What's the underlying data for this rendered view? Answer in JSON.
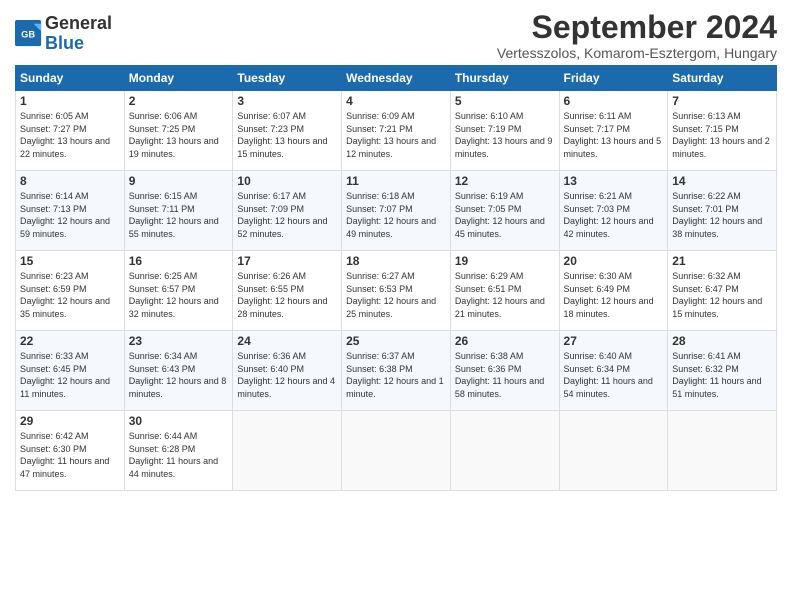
{
  "header": {
    "logo_general": "General",
    "logo_blue": "Blue",
    "month_title": "September 2024",
    "subtitle": "Vertesszolos, Komarom-Esztergom, Hungary"
  },
  "weekdays": [
    "Sunday",
    "Monday",
    "Tuesday",
    "Wednesday",
    "Thursday",
    "Friday",
    "Saturday"
  ],
  "weeks": [
    [
      {
        "day": "1",
        "sunrise": "6:05 AM",
        "sunset": "7:27 PM",
        "daylight": "13 hours and 22 minutes."
      },
      {
        "day": "2",
        "sunrise": "6:06 AM",
        "sunset": "7:25 PM",
        "daylight": "13 hours and 19 minutes."
      },
      {
        "day": "3",
        "sunrise": "6:07 AM",
        "sunset": "7:23 PM",
        "daylight": "13 hours and 15 minutes."
      },
      {
        "day": "4",
        "sunrise": "6:09 AM",
        "sunset": "7:21 PM",
        "daylight": "13 hours and 12 minutes."
      },
      {
        "day": "5",
        "sunrise": "6:10 AM",
        "sunset": "7:19 PM",
        "daylight": "13 hours and 9 minutes."
      },
      {
        "day": "6",
        "sunrise": "6:11 AM",
        "sunset": "7:17 PM",
        "daylight": "13 hours and 5 minutes."
      },
      {
        "day": "7",
        "sunrise": "6:13 AM",
        "sunset": "7:15 PM",
        "daylight": "13 hours and 2 minutes."
      }
    ],
    [
      {
        "day": "8",
        "sunrise": "6:14 AM",
        "sunset": "7:13 PM",
        "daylight": "12 hours and 59 minutes."
      },
      {
        "day": "9",
        "sunrise": "6:15 AM",
        "sunset": "7:11 PM",
        "daylight": "12 hours and 55 minutes."
      },
      {
        "day": "10",
        "sunrise": "6:17 AM",
        "sunset": "7:09 PM",
        "daylight": "12 hours and 52 minutes."
      },
      {
        "day": "11",
        "sunrise": "6:18 AM",
        "sunset": "7:07 PM",
        "daylight": "12 hours and 49 minutes."
      },
      {
        "day": "12",
        "sunrise": "6:19 AM",
        "sunset": "7:05 PM",
        "daylight": "12 hours and 45 minutes."
      },
      {
        "day": "13",
        "sunrise": "6:21 AM",
        "sunset": "7:03 PM",
        "daylight": "12 hours and 42 minutes."
      },
      {
        "day": "14",
        "sunrise": "6:22 AM",
        "sunset": "7:01 PM",
        "daylight": "12 hours and 38 minutes."
      }
    ],
    [
      {
        "day": "15",
        "sunrise": "6:23 AM",
        "sunset": "6:59 PM",
        "daylight": "12 hours and 35 minutes."
      },
      {
        "day": "16",
        "sunrise": "6:25 AM",
        "sunset": "6:57 PM",
        "daylight": "12 hours and 32 minutes."
      },
      {
        "day": "17",
        "sunrise": "6:26 AM",
        "sunset": "6:55 PM",
        "daylight": "12 hours and 28 minutes."
      },
      {
        "day": "18",
        "sunrise": "6:27 AM",
        "sunset": "6:53 PM",
        "daylight": "12 hours and 25 minutes."
      },
      {
        "day": "19",
        "sunrise": "6:29 AM",
        "sunset": "6:51 PM",
        "daylight": "12 hours and 21 minutes."
      },
      {
        "day": "20",
        "sunrise": "6:30 AM",
        "sunset": "6:49 PM",
        "daylight": "12 hours and 18 minutes."
      },
      {
        "day": "21",
        "sunrise": "6:32 AM",
        "sunset": "6:47 PM",
        "daylight": "12 hours and 15 minutes."
      }
    ],
    [
      {
        "day": "22",
        "sunrise": "6:33 AM",
        "sunset": "6:45 PM",
        "daylight": "12 hours and 11 minutes."
      },
      {
        "day": "23",
        "sunrise": "6:34 AM",
        "sunset": "6:43 PM",
        "daylight": "12 hours and 8 minutes."
      },
      {
        "day": "24",
        "sunrise": "6:36 AM",
        "sunset": "6:40 PM",
        "daylight": "12 hours and 4 minutes."
      },
      {
        "day": "25",
        "sunrise": "6:37 AM",
        "sunset": "6:38 PM",
        "daylight": "12 hours and 1 minute."
      },
      {
        "day": "26",
        "sunrise": "6:38 AM",
        "sunset": "6:36 PM",
        "daylight": "11 hours and 58 minutes."
      },
      {
        "day": "27",
        "sunrise": "6:40 AM",
        "sunset": "6:34 PM",
        "daylight": "11 hours and 54 minutes."
      },
      {
        "day": "28",
        "sunrise": "6:41 AM",
        "sunset": "6:32 PM",
        "daylight": "11 hours and 51 minutes."
      }
    ],
    [
      {
        "day": "29",
        "sunrise": "6:42 AM",
        "sunset": "6:30 PM",
        "daylight": "11 hours and 47 minutes."
      },
      {
        "day": "30",
        "sunrise": "6:44 AM",
        "sunset": "6:28 PM",
        "daylight": "11 hours and 44 minutes."
      },
      null,
      null,
      null,
      null,
      null
    ]
  ]
}
